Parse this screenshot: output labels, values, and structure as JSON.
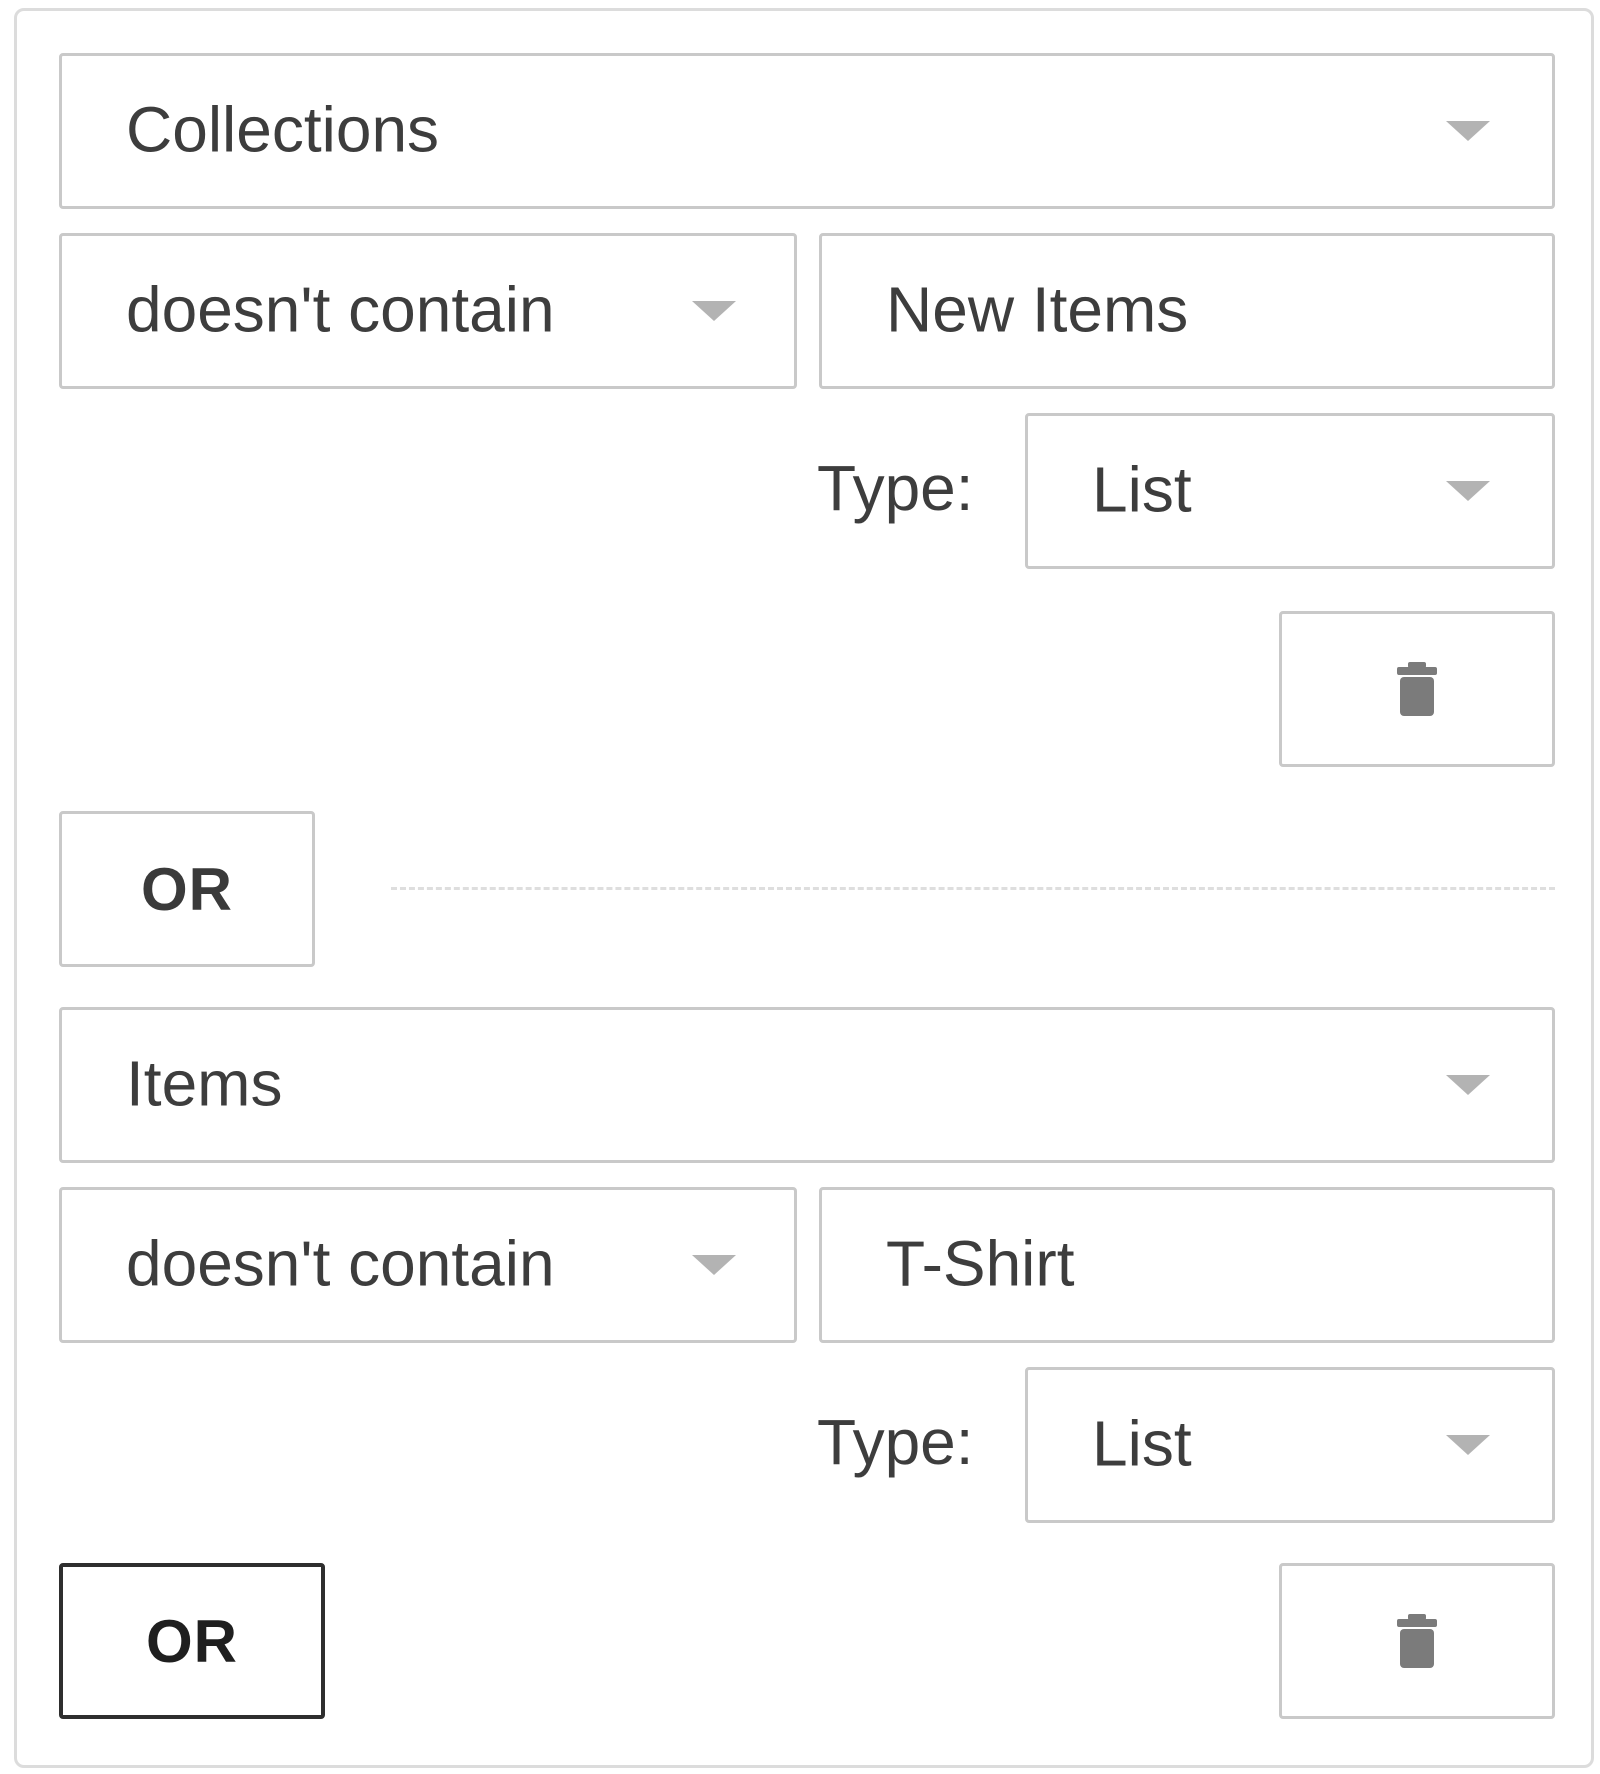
{
  "conditions": [
    {
      "field": "Collections",
      "operator": "doesn't contain",
      "value": "New Items",
      "type_label": "Type:",
      "type_value": "List",
      "delete_icon": "trash-icon"
    },
    {
      "field": "Items",
      "operator": "doesn't contain",
      "value": "T-Shirt",
      "type_label": "Type:",
      "type_value": "List",
      "delete_icon": "trash-icon"
    }
  ],
  "or_button_label": "OR",
  "colors": {
    "border": "#c9c9c9",
    "text": "#3d3d3d",
    "caret": "#b3b3b3",
    "active_border": "#2e2e2e"
  }
}
